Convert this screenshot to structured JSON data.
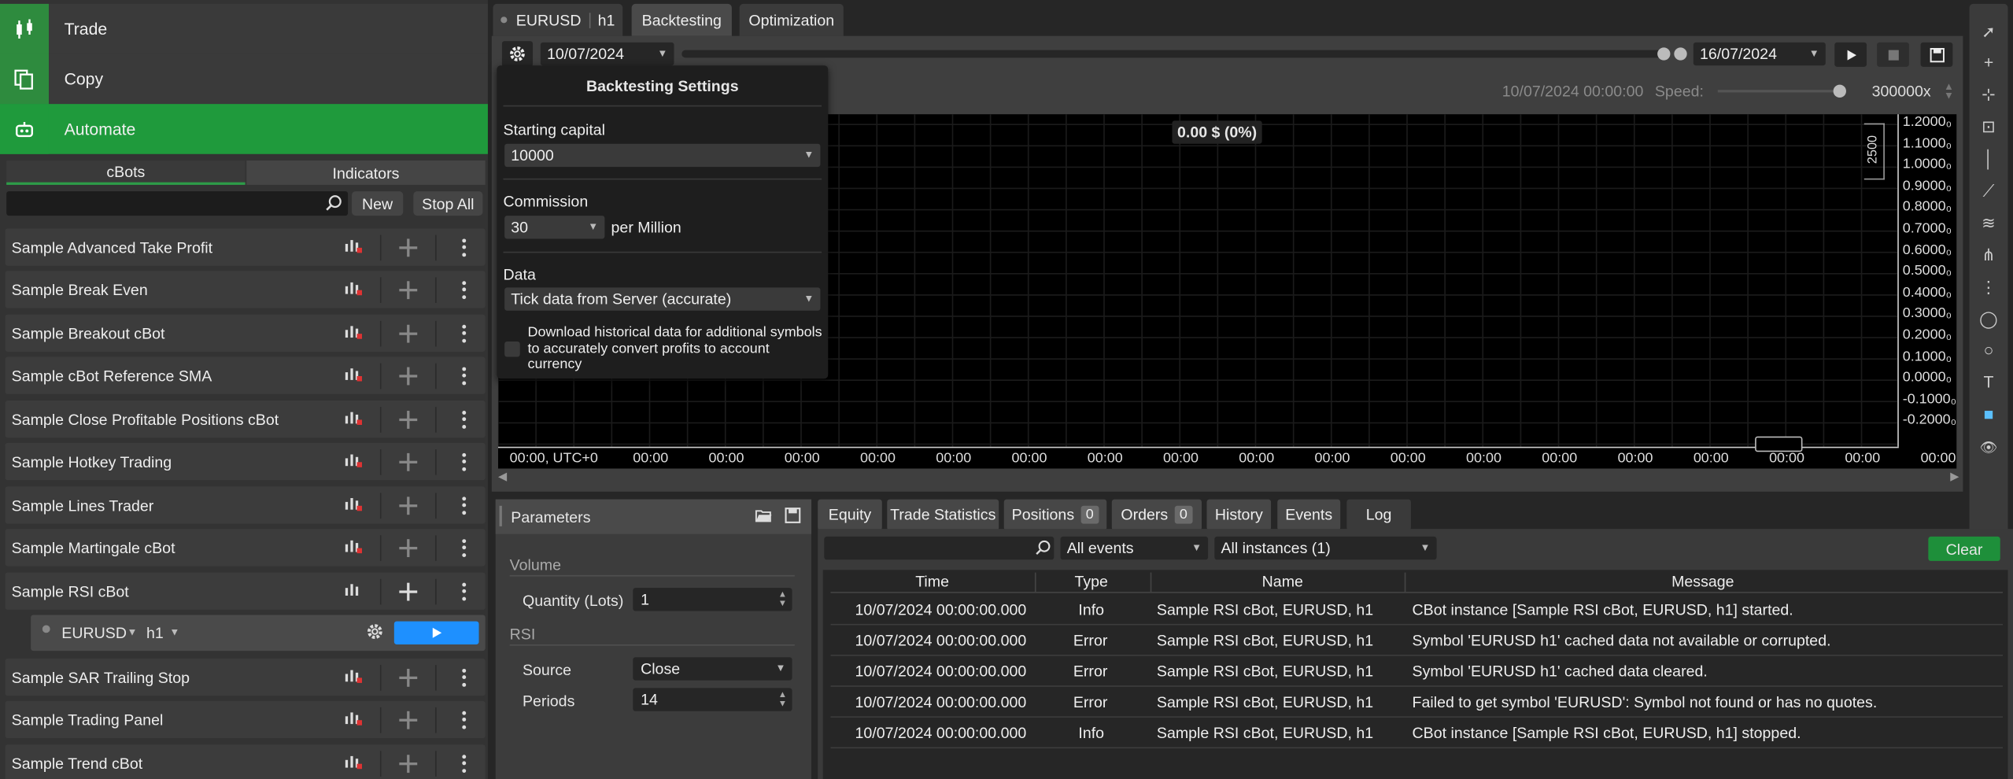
{
  "nav": [
    {
      "label": "Trade",
      "icon": "candlestick-icon"
    },
    {
      "label": "Copy",
      "icon": "copy-icon"
    },
    {
      "label": "Automate",
      "icon": "robot-icon"
    }
  ],
  "subtabs": {
    "cbots": "cBots",
    "indicators": "Indicators"
  },
  "toolbar": {
    "new_label": "New",
    "stop_all_label": "Stop All"
  },
  "bots": [
    "Sample Advanced Take Profit",
    "Sample Break Even",
    "Sample Breakout cBot",
    "Sample cBot Reference SMA",
    "Sample Close Profitable Positions cBot",
    "Sample Hotkey Trading",
    "Sample Lines Trader",
    "Sample Martingale cBot",
    "Sample RSI cBot",
    "Sample SAR Trailing Stop",
    "Sample Trading Panel",
    "Sample Trend cBot"
  ],
  "instance": {
    "symbol": "EURUSD",
    "timeframe": "h1"
  },
  "top_tabs": {
    "symbol": "EURUSD",
    "timeframe": "h1",
    "backtesting": "Backtesting",
    "optimization": "Optimization"
  },
  "range": {
    "start_date": "10/07/2024",
    "end_date": "16/07/2024"
  },
  "playback": {
    "current_time": "10/07/2024 00:00:00",
    "speed_label": "Speed:",
    "speed_value": "300000x",
    "speed_fraction": 0.95
  },
  "settings_popup": {
    "title": "Backtesting Settings",
    "starting_capital_label": "Starting capital",
    "starting_capital": "10000",
    "commission_label": "Commission",
    "commission": "30",
    "commission_unit": "per Million",
    "data_label": "Data",
    "data_source": "Tick data from Server (accurate)",
    "download_checkbox_label": "Download historical data for additional symbols to accurately convert profits to account currency",
    "download_checked": false
  },
  "chart": {
    "balance_label": "0.00 $ (0%)",
    "volume_scale": "2500",
    "y_ticks": [
      "1.2000₀",
      "1.1000₀",
      "1.0000₀",
      "0.9000₀",
      "0.8000₀",
      "0.7000₀",
      "0.6000₀",
      "0.5000₀",
      "0.4000₀",
      "0.3000₀",
      "0.2000₀",
      "0.1000₀",
      "0.0000₀",
      "-0.1000₀",
      "-0.2000₀"
    ],
    "x_ticks": [
      "00:00, UTC+0",
      "00:00",
      "00:00",
      "00:00",
      "00:00",
      "00:00",
      "00:00",
      "00:00",
      "00:00",
      "00:00",
      "00:00",
      "00:00",
      "00:00",
      "00:00",
      "00:00",
      "00:00",
      "00:00",
      "00:00",
      "00:00"
    ]
  },
  "parameters": {
    "title": "Parameters",
    "volume_group": "Volume",
    "quantity_label": "Quantity (Lots)",
    "quantity": "1",
    "rsi_group": "RSI",
    "source_label": "Source",
    "source": "Close",
    "periods_label": "Periods",
    "periods": "14"
  },
  "log_tabs": {
    "equity": "Equity",
    "trade_statistics": "Trade Statistics",
    "positions": "Positions",
    "positions_count": "0",
    "orders": "Orders",
    "orders_count": "0",
    "history": "History",
    "events": "Events",
    "log": "Log"
  },
  "log_filters": {
    "events": "All events",
    "instances": "All instances (1)",
    "clear_label": "Clear"
  },
  "log_columns": {
    "time": "Time",
    "type": "Type",
    "name": "Name",
    "message": "Message"
  },
  "log_rows": [
    {
      "time": "10/07/2024 00:00:00.000",
      "type": "Info",
      "name": "Sample RSI cBot, EURUSD, h1",
      "message": "CBot instance [Sample RSI cBot, EURUSD, h1] started."
    },
    {
      "time": "10/07/2024 00:00:00.000",
      "type": "Error",
      "name": "Sample RSI cBot, EURUSD, h1",
      "message": "Symbol 'EURUSD h1' cached data not available or corrupted."
    },
    {
      "time": "10/07/2024 00:00:00.000",
      "type": "Error",
      "name": "Sample RSI cBot, EURUSD, h1",
      "message": "Symbol 'EURUSD h1' cached data cleared."
    },
    {
      "time": "10/07/2024 00:00:00.000",
      "type": "Error",
      "name": "Sample RSI cBot, EURUSD, h1",
      "message": "Failed to get symbol 'EURUSD': Symbol not found or has no quotes."
    },
    {
      "time": "10/07/2024 00:00:00.000",
      "type": "Info",
      "name": "Sample RSI cBot, EURUSD, h1",
      "message": "CBot instance [Sample RSI cBot, EURUSD, h1] stopped."
    }
  ],
  "colors": {
    "accent_green": "#1f9a3c",
    "play_blue": "#1e90ff",
    "clear_green": "#1e8f3a"
  }
}
